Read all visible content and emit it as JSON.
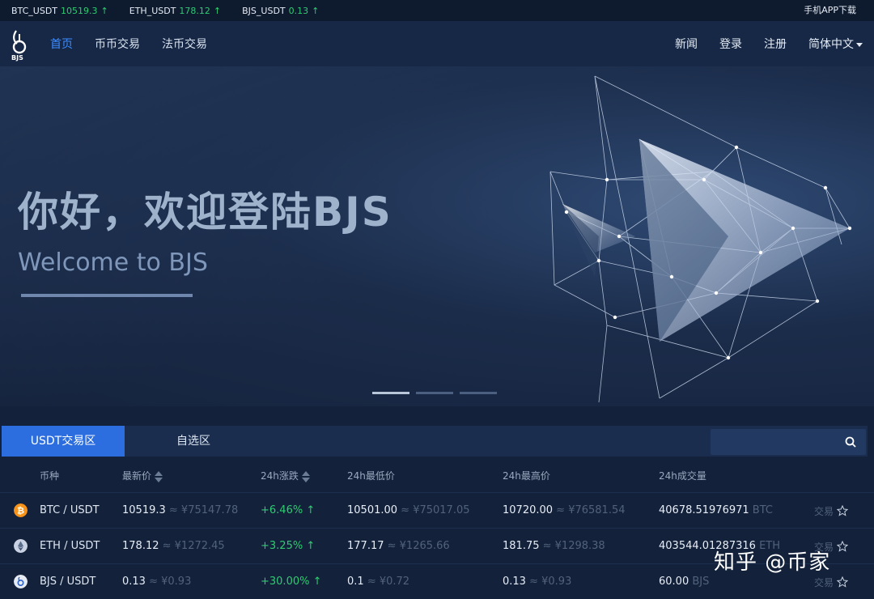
{
  "ticker": {
    "items": [
      {
        "pair": "BTC_USDT",
        "price": "10519.3",
        "arrow": "↑"
      },
      {
        "pair": "ETH_USDT",
        "price": "178.12",
        "arrow": "↑"
      },
      {
        "pair": "BJS_USDT",
        "price": "0.13",
        "arrow": "↑"
      }
    ],
    "app_download": "手机APP下载"
  },
  "nav": {
    "logo_text": "BJS",
    "links": [
      "首页",
      "币币交易",
      "法币交易"
    ],
    "right": {
      "news": "新闻",
      "login": "登录",
      "register": "注册",
      "language": "简体中文"
    }
  },
  "banner": {
    "title_cn": "你好，欢迎登陆BJS",
    "title_en": "Welcome to BJS"
  },
  "market": {
    "tabs": [
      "USDT交易区",
      "自选区"
    ],
    "search_placeholder": "",
    "headers": {
      "coin": "币种",
      "last": "最新价",
      "change": "24h涨跌",
      "low": "24h最低价",
      "high": "24h最高价",
      "volume": "24h成交量"
    },
    "rows": [
      {
        "icon": "bitcoin-icon",
        "icon_color": "#f7931a",
        "pair": "BTC / USDT",
        "last": "10519.3",
        "last_cny": "≈ ¥75147.78",
        "change": "+6.46% ↑",
        "low": "10501.00",
        "low_cny": "≈ ¥75017.05",
        "high": "10720.00",
        "high_cny": "≈ ¥76581.54",
        "volume": "40678.51976971",
        "volume_unit": "BTC",
        "trade": "交易"
      },
      {
        "icon": "ethereum-icon",
        "icon_color": "#c8d2e2",
        "pair": "ETH / USDT",
        "last": "178.12",
        "last_cny": "≈ ¥1272.45",
        "change": "+3.25% ↑",
        "low": "177.17",
        "low_cny": "≈ ¥1265.66",
        "high": "181.75",
        "high_cny": "≈ ¥1298.38",
        "volume": "403544.01287316",
        "volume_unit": "ETH",
        "trade": "交易"
      },
      {
        "icon": "bjs-icon",
        "icon_color": "#e6ebf3",
        "pair": "BJS / USDT",
        "last": "0.13",
        "last_cny": "≈ ¥0.93",
        "change": "+30.00% ↑",
        "low": "0.1",
        "low_cny": "≈ ¥0.72",
        "high": "0.13",
        "high_cny": "≈ ¥0.93",
        "volume": "60.00",
        "volume_unit": "BJS",
        "trade": "交易"
      }
    ]
  },
  "watermark": "知乎 @币家",
  "colors": {
    "accent": "#2c6ee0",
    "up": "#2ecc71",
    "nav_active": "#3d8bff"
  }
}
